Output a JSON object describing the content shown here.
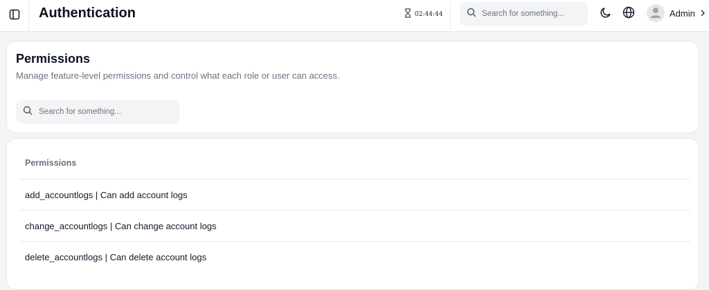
{
  "header": {
    "title": "Authentication",
    "timer": "02:44:44",
    "search": {
      "placeholder": "Search for something...",
      "value": ""
    },
    "user": {
      "name": "Admin"
    },
    "icons": [
      "sidebar-toggle-icon",
      "hourglass-icon",
      "search-icon",
      "moon-icon",
      "globe-icon",
      "user-icon",
      "chevron-right-icon"
    ]
  },
  "permissions_card": {
    "title": "Permissions",
    "description": "Manage feature-level permissions and control what each role or user can access.",
    "search": {
      "placeholder": "Search for something...",
      "value": ""
    }
  },
  "permissions_list": {
    "header": "Permissions",
    "rows": [
      "add_accountlogs | Can add account logs",
      "change_accountlogs | Can change account logs",
      "delete_accountlogs | Can delete account logs"
    ]
  }
}
